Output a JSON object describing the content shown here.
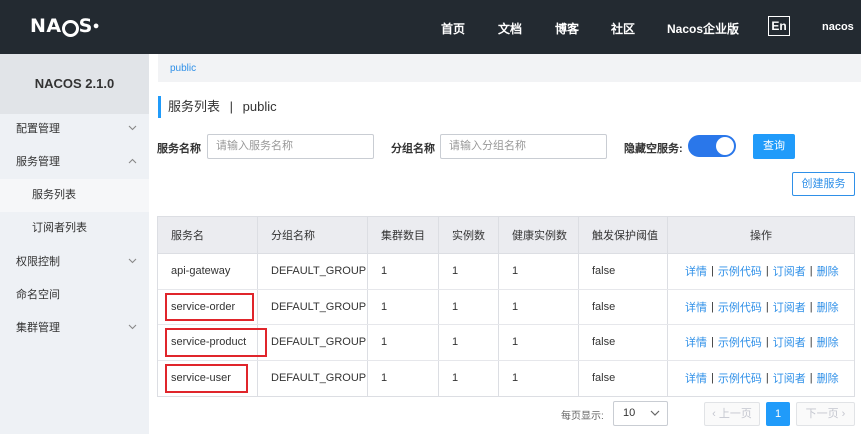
{
  "header": {
    "logo": {
      "prefix": "NA",
      "suffix": "S"
    },
    "nav": [
      "首页",
      "文档",
      "博客",
      "社区",
      "Nacos企业版"
    ],
    "lang": "En",
    "user": "nacos"
  },
  "sidebar": {
    "title": "NACOS 2.1.0",
    "items": [
      {
        "label": "配置管理",
        "chevron": "down"
      },
      {
        "label": "服务管理",
        "chevron": "up"
      },
      {
        "label": "服务列表",
        "chevron": ""
      },
      {
        "label": "订阅者列表",
        "chevron": ""
      },
      {
        "label": "权限控制",
        "chevron": "down"
      },
      {
        "label": "命名空间",
        "chevron": ""
      },
      {
        "label": "集群管理",
        "chevron": "down"
      }
    ]
  },
  "breadcrumb": "public",
  "page_title": {
    "main": "服务列表",
    "separator": "|",
    "namespace": "public"
  },
  "filters": {
    "service_name_label": "服务名称",
    "service_name_placeholder": "请输入服务名称",
    "group_name_label": "分组名称",
    "group_name_placeholder": "请输入分组名称",
    "hide_empty_label": "隐藏空服务:",
    "hide_empty_on": true,
    "query_button": "查询",
    "create_button": "创建服务"
  },
  "table": {
    "headers": [
      "服务名",
      "分组名称",
      "集群数目",
      "实例数",
      "健康实例数",
      "触发保护阈值",
      "操作"
    ],
    "rows": [
      {
        "name": "api-gateway",
        "group": "DEFAULT_GROUP",
        "clusters": "1",
        "instances": "1",
        "healthy": "1",
        "threshold": "false",
        "highlighted": false
      },
      {
        "name": "service-order",
        "group": "DEFAULT_GROUP",
        "clusters": "1",
        "instances": "1",
        "healthy": "1",
        "threshold": "false",
        "highlighted": true
      },
      {
        "name": "service-product",
        "group": "DEFAULT_GROUP",
        "clusters": "1",
        "instances": "1",
        "healthy": "1",
        "threshold": "false",
        "highlighted": true
      },
      {
        "name": "service-user",
        "group": "DEFAULT_GROUP",
        "clusters": "1",
        "instances": "1",
        "healthy": "1",
        "threshold": "false",
        "highlighted": true
      }
    ],
    "actions": [
      "详情",
      "示例代码",
      "订阅者",
      "删除"
    ],
    "action_separator": "|"
  },
  "pagination": {
    "page_size_label": "每页显示:",
    "page_size": "10",
    "prev": "上一页",
    "current": "1",
    "next": "下一页"
  },
  "colors": {
    "topbar": "#232a31",
    "accent": "#209bfa",
    "link": "#2f90e8",
    "highlight_box": "#e0252b"
  }
}
